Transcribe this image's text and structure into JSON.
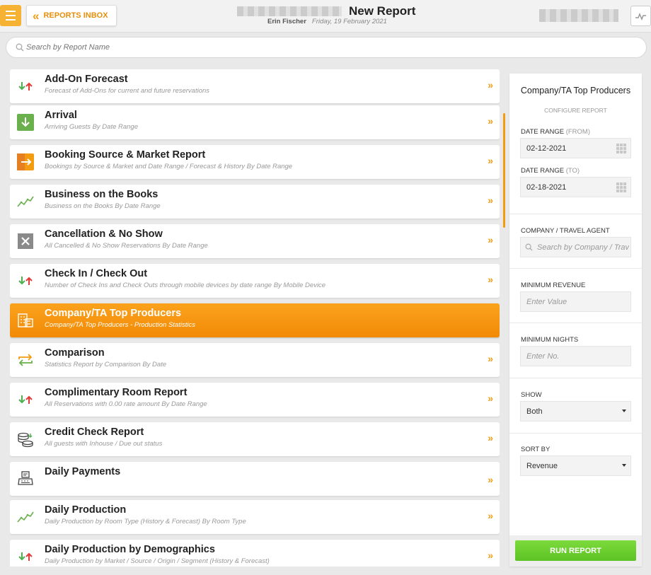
{
  "header": {
    "inbox_label": "REPORTS INBOX",
    "title": "New Report",
    "user": "Erin Fischer",
    "date": "Friday, 19 February 2021"
  },
  "search": {
    "placeholder": "Search by Report Name"
  },
  "colors": {
    "accent": "#f39c12",
    "active_bg": "#f7941d",
    "run_green": "#6ad131"
  },
  "reports": [
    {
      "name": "Add-On Forecast",
      "desc": "Forecast of Add-Ons for current and future reservations",
      "icon": "arrows-updown-icon"
    },
    {
      "name": "Arrival",
      "desc": "Arriving Guests By Date Range",
      "icon": "arrival-icon"
    },
    {
      "name": "Booking Source & Market Report",
      "desc": "Bookings by Source & Market and Date Range / Forecast & History By Date Range",
      "icon": "booking-source-icon"
    },
    {
      "name": "Business on the Books",
      "desc": "Business on the Books By Date Range",
      "icon": "trend-line-icon"
    },
    {
      "name": "Cancellation & No Show",
      "desc": "All Cancelled & No Show Reservations By Date Range",
      "icon": "cancel-x-icon"
    },
    {
      "name": "Check In / Check Out",
      "desc": "Number of Check Ins and Check Outs through mobile devices by date range By Mobile Device",
      "icon": "arrows-updown-icon"
    },
    {
      "name": "Company/TA Top Producers",
      "desc": "Company/TA Top Producers - Production Statistics",
      "icon": "building-icon"
    },
    {
      "name": "Comparison",
      "desc": "Statistics Report by Comparison By Date",
      "icon": "compare-arrows-icon"
    },
    {
      "name": "Complimentary Room Report",
      "desc": "All Reservations with 0.00 rate amount By Date Range",
      "icon": "arrows-updown-icon"
    },
    {
      "name": "Credit Check Report",
      "desc": "All guests with Inhouse / Due out status",
      "icon": "coins-icon"
    },
    {
      "name": "Daily Payments",
      "desc": "",
      "icon": "register-icon"
    },
    {
      "name": "Daily Production",
      "desc": "Daily Production by Room Type (History & Forecast) By Room Type",
      "icon": "trend-line-icon"
    },
    {
      "name": "Daily Production by Demographics",
      "desc": "Daily Production by Market / Source / Origin / Segment (History & Forecast)",
      "icon": "arrows-updown-icon"
    }
  ],
  "config": {
    "title": "Company/TA Top Producers",
    "subtitle": "CONFIGURE REPORT",
    "date_from_label": "DATE RANGE",
    "date_from_hint": "(FROM)",
    "date_from_value": "02-12-2021",
    "date_to_label": "DATE RANGE",
    "date_to_hint": "(TO)",
    "date_to_value": "02-18-2021",
    "company_label": "COMPANY / TRAVEL AGENT",
    "company_placeholder": "Search by Company / Trav",
    "min_revenue_label": "MINIMUM REVENUE",
    "min_revenue_placeholder": "Enter Value",
    "min_nights_label": "MINIMUM NIGHTS",
    "min_nights_placeholder": "Enter No.",
    "show_label": "SHOW",
    "show_value": "Both",
    "sort_label": "SORT BY",
    "sort_value": "Revenue",
    "run_label": "RUN REPORT"
  }
}
